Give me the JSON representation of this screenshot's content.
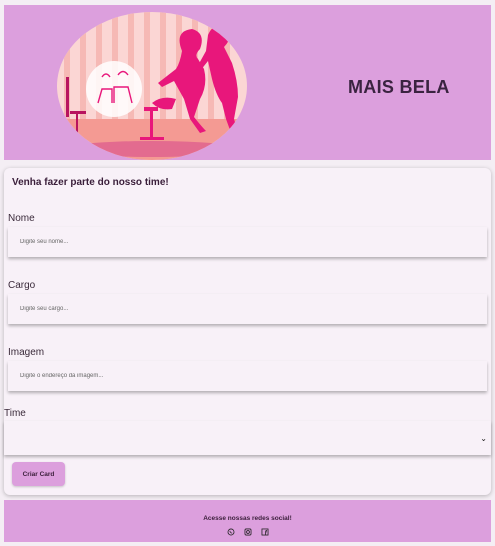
{
  "header": {
    "brand": "MAIS BELA",
    "logo_icon": "salon-silhouette-icon"
  },
  "form": {
    "title": "Venha fazer parte do nosso time!",
    "fields": [
      {
        "label": "Nome",
        "placeholder": "Digite seu nome..."
      },
      {
        "label": "Cargo",
        "placeholder": "Digite seu cargo..."
      },
      {
        "label": "Imagem",
        "placeholder": "Digite o endereço da imagem..."
      }
    ],
    "time_label": "Time",
    "time_value": "",
    "submit_label": "Criar Card"
  },
  "footer": {
    "text": "Acesse nossas redes social!",
    "social_icons": [
      "whatsapp-icon",
      "instagram-icon",
      "facebook-icon"
    ]
  },
  "colors": {
    "accent": "#dc9fdd",
    "card_bg": "#f8f1f8",
    "logo_pink": "#e8177b"
  }
}
